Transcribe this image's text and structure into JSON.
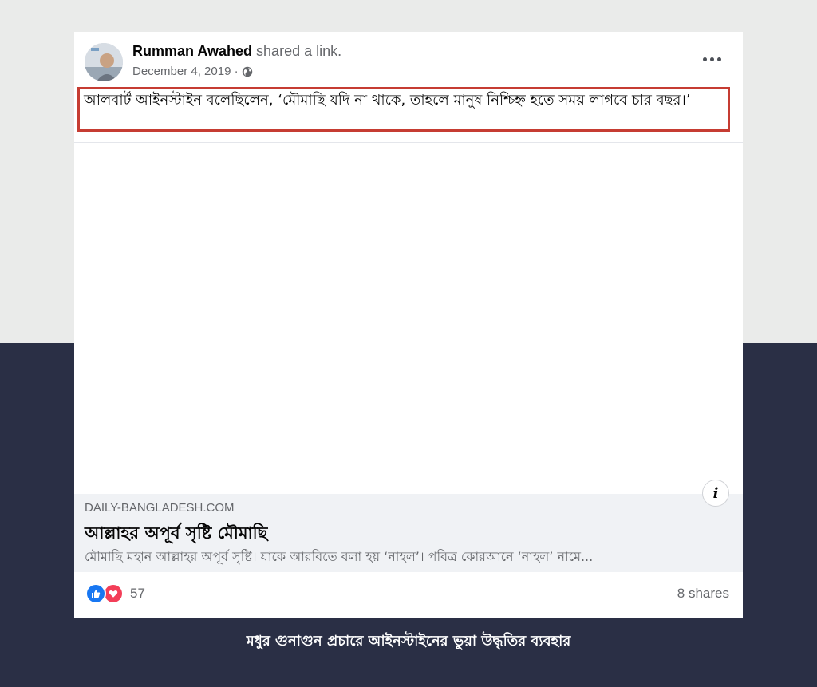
{
  "post": {
    "author_name": "Rumman Awahed",
    "shared_text": "shared a link.",
    "date": "December 4, 2019 ·",
    "privacy_icon": "globe-icon",
    "more_icon": "more-icon",
    "text": "আলবার্ট আইনস্টাইন বলেছিলেন, ‘মৌমাছি যদি না থাকে, তাহলে মানুষ নিশ্চিহ্ন হতে সময় লাগবে চার বছর।’"
  },
  "link": {
    "domain": "DAILY-BANGLADESH.COM",
    "title": "আল্লাহর অপূর্ব সৃষ্টি মৌমাছি",
    "description": "মৌমাছি মহান আল্লাহর অপূর্ব সৃষ্টি। যাকে আরবিতে বলা হয় ‘নাহল’। পবিত্র কোরআনে ‘নাহল’ নামে...",
    "info_icon": "i"
  },
  "engagement": {
    "reaction_count": "57",
    "shares": "8 shares"
  },
  "caption": "মধুর গুনাগুন প্রচারে আইনস্টাইনের ভুয়া উদ্ধৃতির ব্যবহার",
  "colors": {
    "highlight": "#c63c32",
    "dark_band": "#2a2f45",
    "like": "#1877f2",
    "love": "#f33e58"
  }
}
